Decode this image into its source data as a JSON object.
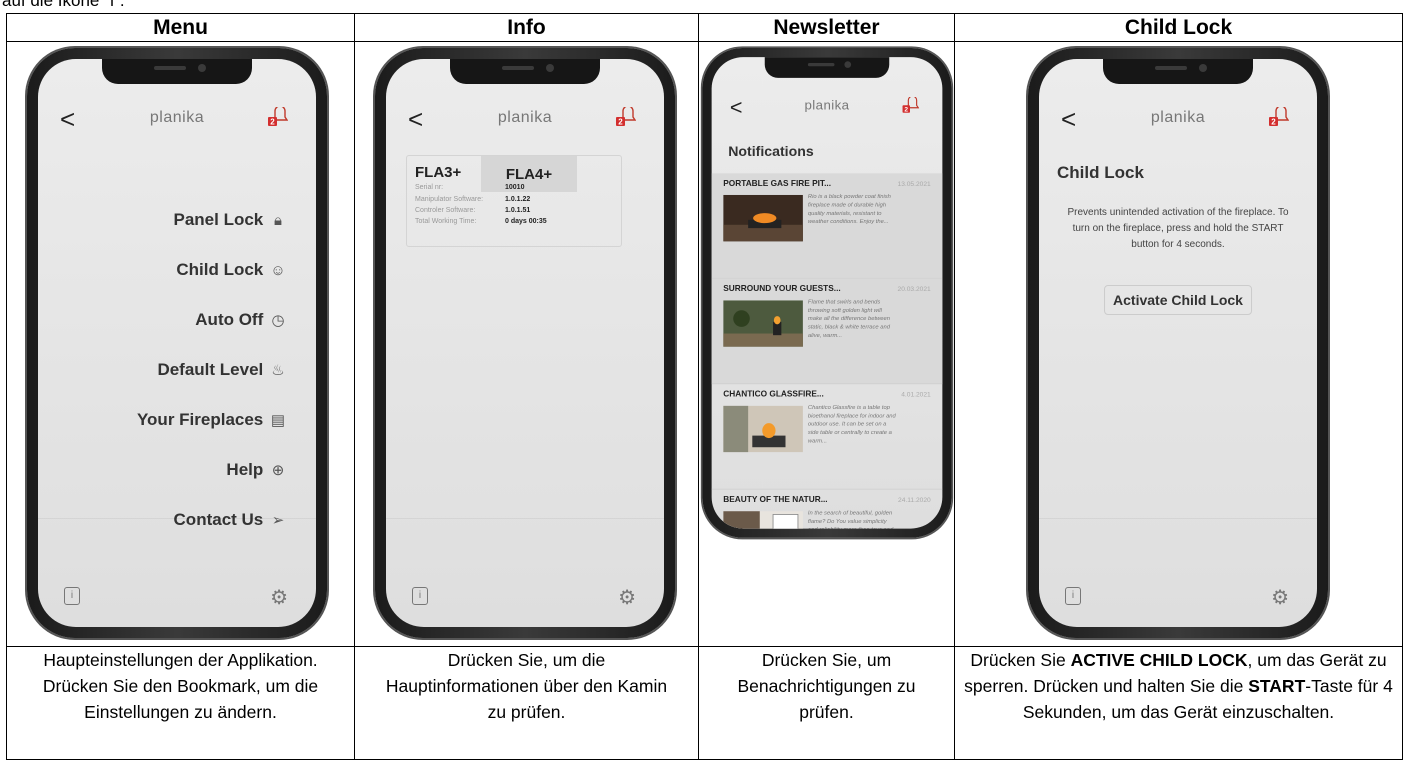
{
  "top_text": "auf die Ikone \"i\".",
  "columns": [
    {
      "header": "Menu"
    },
    {
      "header": "Info"
    },
    {
      "header": "Newsletter"
    },
    {
      "header": "Child Lock"
    }
  ],
  "app": {
    "brand": "planika",
    "back": "<",
    "badge": "2"
  },
  "menu_screen": {
    "items": [
      {
        "label": "Panel Lock",
        "icon": "lock-icon"
      },
      {
        "label": "Child Lock",
        "icon": "child-face-icon"
      },
      {
        "label": "Auto Off",
        "icon": "clock-icon"
      },
      {
        "label": "Default Level",
        "icon": "flame-icon"
      },
      {
        "label": "Your Fireplaces",
        "icon": "fireplace-icon"
      },
      {
        "label": "Help",
        "icon": "lifebuoy-icon"
      },
      {
        "label": "Contact Us",
        "icon": "send-icon"
      }
    ]
  },
  "info_screen": {
    "tab_a": "FLA3+",
    "tab_b": "FLA4+",
    "rows": [
      {
        "label": "Serial nr:",
        "value": "10010"
      },
      {
        "label": "Manipulator Software:",
        "value": "1.0.1.22"
      },
      {
        "label": "Controler Software:",
        "value": "1.0.1.51"
      },
      {
        "label": "Total Working Time:",
        "value": "0 days 00:35"
      }
    ]
  },
  "news_screen": {
    "title": "Notifications",
    "items": [
      {
        "title": "PORTABLE GAS FIRE PIT...",
        "date": "13.05.2021",
        "text": "Rio is a black powder coat finish fireplace made of durable high quality materials, resistant to weather conditions. Enjoy the..."
      },
      {
        "title": "SURROUND YOUR GUESTS...",
        "date": "20.03.2021",
        "text": "Flame that swirls and bends throwing soft golden light will make all the difference between static, black & white terrace and alive, warm..."
      },
      {
        "title": "CHANTICO GLASSFIRE...",
        "date": "4.01.2021",
        "text": "Chantico Glassfire is a table top bioethanol fireplace for indoor and outdoor use. It can be set on a side table or centrally to create a warm..."
      },
      {
        "title": "BEAUTY OF THE NATUR...",
        "date": "24.11.2020",
        "text": "In the search of beautiful, golden flame? Do You value simplicity and reliability more than toys and gizmos? Primefire+ checks all the ..."
      }
    ]
  },
  "childlock_screen": {
    "title": "Child Lock",
    "text": "Prevents unintended activation of the fireplace. To turn on the fireplace, press and hold the START button for 4 seconds.",
    "button": "Activate Child Lock"
  },
  "descriptions": {
    "menu": "Haupteinstellungen der Applikation. Drücken Sie den Bookmark, um die Einstellungen zu ändern.",
    "info": "Drücken Sie, um die Hauptinformationen über den Kamin zu prüfen.",
    "news": "Drücken Sie, um Benachrichtigungen zu prüfen.",
    "child_a": "Drücken Sie ",
    "child_b": "ACTIVE CHILD LOCK",
    "child_c": ", um das Gerät zu sperren. Drücken und halten Sie die ",
    "child_d": "START",
    "child_e": "-Taste für 4 Sekunden, um das Gerät einzuschalten."
  }
}
